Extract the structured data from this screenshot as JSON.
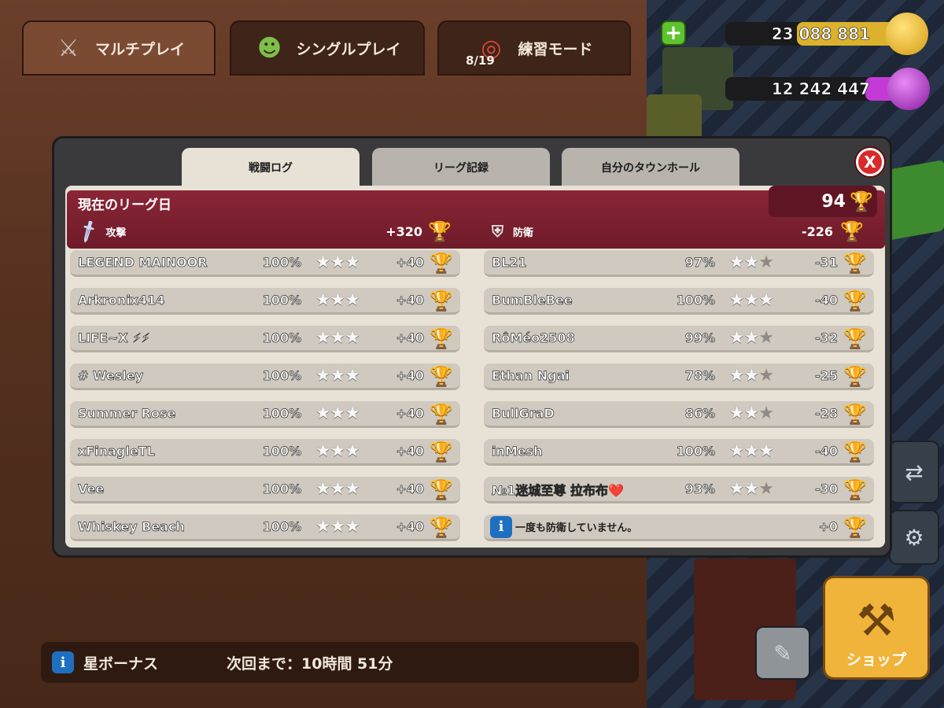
{
  "main_tabs": [
    {
      "label": "マルチプレイ",
      "icon": "crossed-swords-icon"
    },
    {
      "label": "シングルプレイ",
      "icon": "goblin-icon"
    },
    {
      "label": "練習モード",
      "icon": "target-icon",
      "count": "8/19"
    }
  ],
  "resources": {
    "gold": "23 088 881",
    "elixir": "12 242 447",
    "gold_color": "#f2c230",
    "elixir_color": "#c33ad6"
  },
  "modal": {
    "tabs": [
      "戦闘ログ",
      "リーグ記録",
      "自分のタウンホール"
    ],
    "active_tab": 0,
    "close_label": "X",
    "league_day_title": "現在のリーグ日",
    "total_trophies": "94",
    "attack_label": "攻撃",
    "attack_total": "+320",
    "defense_label": "防衛",
    "defense_total": "-226"
  },
  "attacks": [
    {
      "name": "LEGEND MAINOOR",
      "percent": "100%",
      "stars": 3,
      "trophies": "+40"
    },
    {
      "name": "Arkronix414",
      "percent": "100%",
      "stars": 3,
      "trophies": "+40"
    },
    {
      "name": "LIFE~X ⚡⚡",
      "percent": "100%",
      "stars": 3,
      "trophies": "+40"
    },
    {
      "name": "# Wesley",
      "percent": "100%",
      "stars": 3,
      "trophies": "+40"
    },
    {
      "name": "Summer Rose",
      "percent": "100%",
      "stars": 3,
      "trophies": "+40"
    },
    {
      "name": "xFinagleTL",
      "percent": "100%",
      "stars": 3,
      "trophies": "+40"
    },
    {
      "name": "Vee",
      "percent": "100%",
      "stars": 3,
      "trophies": "+40"
    },
    {
      "name": "Whiskey Beach",
      "percent": "100%",
      "stars": 3,
      "trophies": "+40"
    }
  ],
  "defenses": [
    {
      "name": "BL21",
      "percent": "97%",
      "stars": 2,
      "trophies": "-31"
    },
    {
      "name": "BumBleBee",
      "percent": "100%",
      "stars": 3,
      "trophies": "-40"
    },
    {
      "name": "RôMéo2508",
      "percent": "99%",
      "stars": 2,
      "trophies": "-32"
    },
    {
      "name": "Ethan Ngai",
      "percent": "78%",
      "stars": 2,
      "trophies": "-25"
    },
    {
      "name": "BullGraD",
      "percent": "86%",
      "stars": 2,
      "trophies": "-28"
    },
    {
      "name": "inMesh",
      "percent": "100%",
      "stars": 3,
      "trophies": "-40"
    },
    {
      "name": "№1迷城至尊 拉布布❤️",
      "percent": "93%",
      "stars": 2,
      "trophies": "-30"
    }
  ],
  "no_defense": {
    "note": "一度も防衛していません。",
    "trophies": "+0"
  },
  "star_bonus": {
    "label": "星ボーナス",
    "timer": "次回まで：10時間 51分"
  },
  "shop_label": "ショップ"
}
